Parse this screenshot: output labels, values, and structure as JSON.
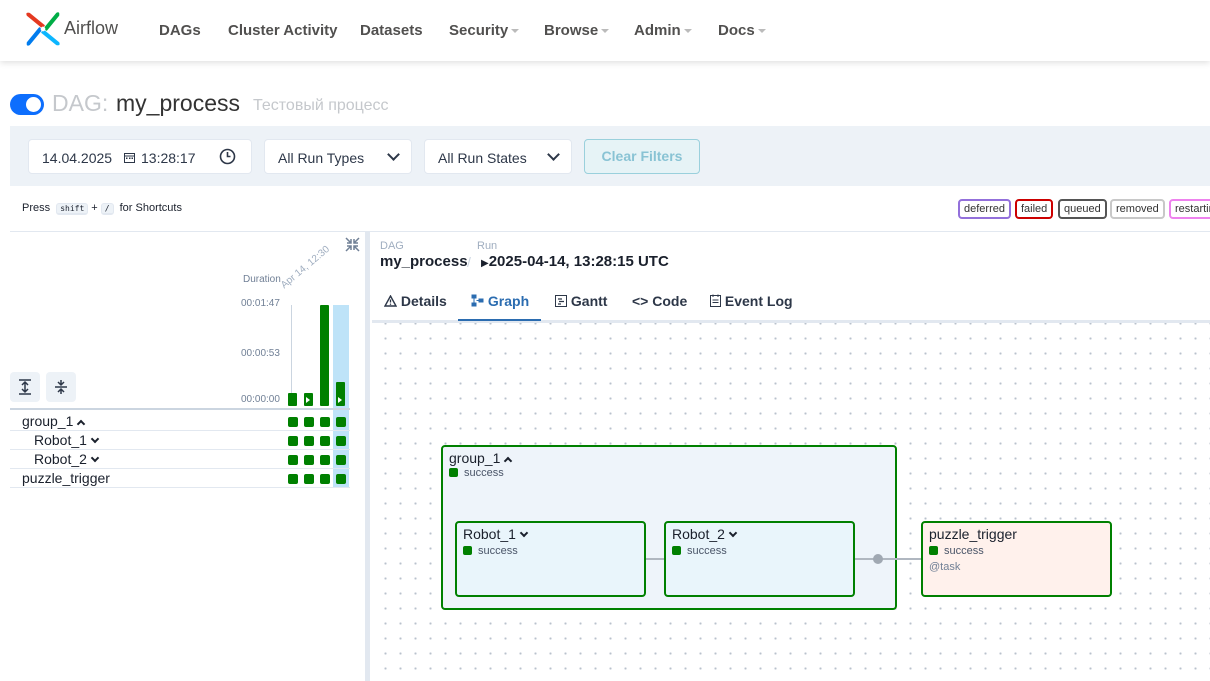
{
  "navbar": {
    "brand": "Airflow",
    "items": [
      {
        "label": "DAGs",
        "dropdown": false
      },
      {
        "label": "Cluster Activity",
        "dropdown": false
      },
      {
        "label": "Datasets",
        "dropdown": false
      },
      {
        "label": "Security",
        "dropdown": true
      },
      {
        "label": "Browse",
        "dropdown": true
      },
      {
        "label": "Admin",
        "dropdown": true
      },
      {
        "label": "Docs",
        "dropdown": true
      }
    ]
  },
  "dag": {
    "prefix": "DAG:",
    "name": "my_process",
    "description": "Тестовый процесс",
    "paused": false
  },
  "filters": {
    "date": "14.04.2025",
    "time": "13:28:17",
    "run_types": "All Run Types",
    "run_states": "All Run States",
    "clear_label": "Clear Filters"
  },
  "shortcuts": {
    "prefix": "Press",
    "key1": "shift",
    "plus": "+",
    "key2": "/",
    "suffix": "for Shortcuts"
  },
  "legend": [
    {
      "label": "deferred",
      "color": "#9370db"
    },
    {
      "label": "failed",
      "color": "#cc0000"
    },
    {
      "label": "queued",
      "color": "#555555"
    },
    {
      "label": "removed",
      "color": "#c8c8c8"
    },
    {
      "label": "restarting",
      "color": "#ee82ee"
    }
  ],
  "grid": {
    "duration_label": "Duration",
    "run_date_label": "Apr 14, 12:30",
    "ticks": [
      "00:01:47",
      "00:00:53",
      "00:00:00"
    ],
    "runs": [
      {
        "duration_fraction": 0.13,
        "icon": false
      },
      {
        "duration_fraction": 0.13,
        "icon": true
      },
      {
        "duration_fraction": 1.0,
        "icon": false
      },
      {
        "duration_fraction": 0.24,
        "icon": true
      }
    ],
    "rows": [
      {
        "label": "group_1",
        "expanded": true
      },
      {
        "label": "Robot_1",
        "expanded": false
      },
      {
        "label": "Robot_2",
        "expanded": false
      },
      {
        "label": "puzzle_trigger",
        "expanded": null
      }
    ]
  },
  "details": {
    "dag_label": "DAG",
    "dag_value": "my_process",
    "run_label": "Run",
    "run_value": "2025-04-14, 13:28:15 UTC",
    "separator": "/",
    "tabs": [
      {
        "label": "Details",
        "icon": "warning-icon",
        "active": false
      },
      {
        "label": "Graph",
        "icon": "graph-icon",
        "active": true
      },
      {
        "label": "Gantt",
        "icon": "gantt-icon",
        "active": false
      },
      {
        "label": "Code",
        "icon": "code-icon",
        "active": false
      },
      {
        "label": "Event Log",
        "icon": "event-log-icon",
        "active": false
      }
    ]
  },
  "graph": {
    "group": {
      "label": "group_1",
      "state": "success"
    },
    "nodes": [
      {
        "label": "Robot_1",
        "state": "success"
      },
      {
        "label": "Robot_2",
        "state": "success"
      },
      {
        "label": "puzzle_trigger",
        "state": "success",
        "operator": "@task"
      }
    ]
  }
}
